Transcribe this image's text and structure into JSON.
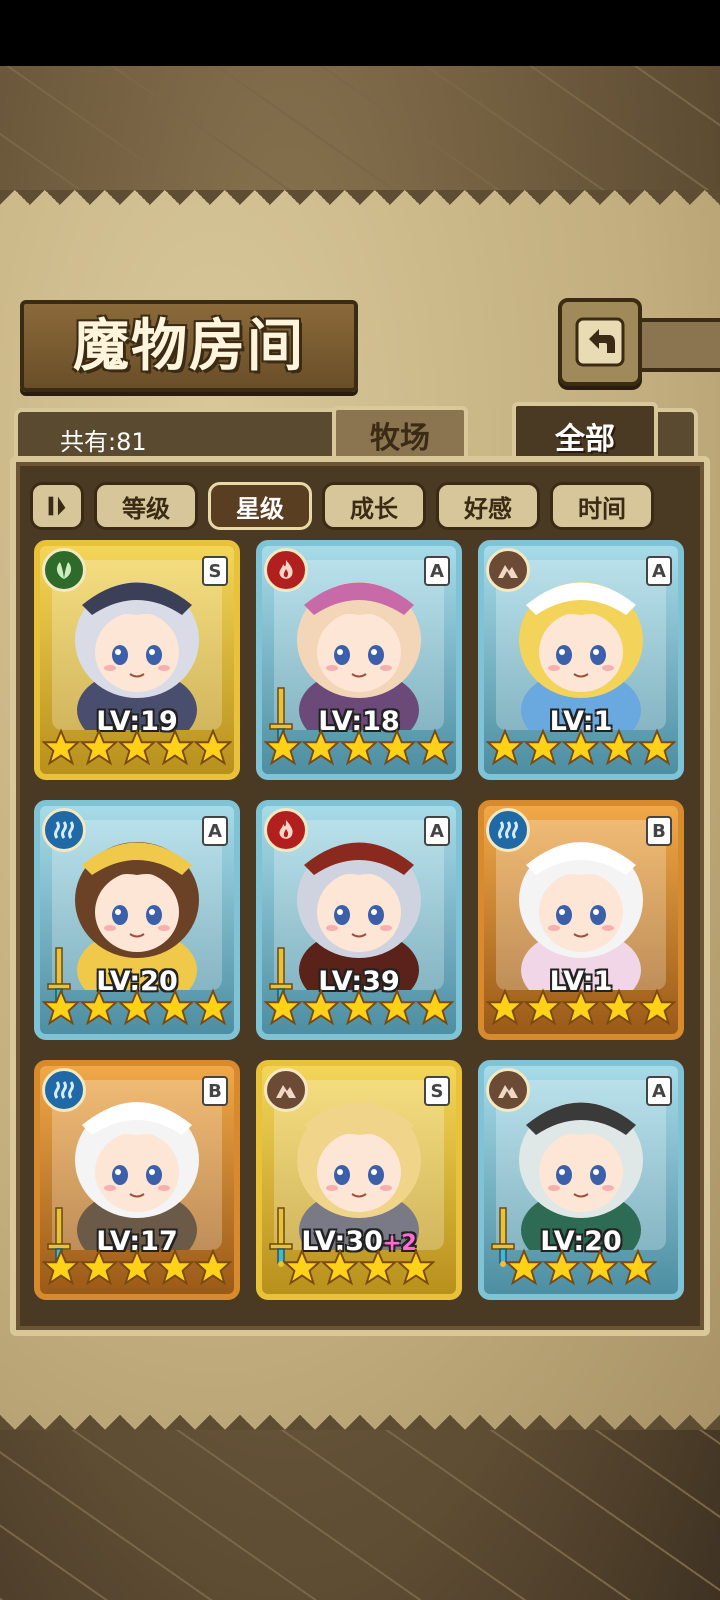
{
  "header": {
    "title": "魔物房间"
  },
  "tabs": {
    "count_label": "共有:81",
    "ranch": "牧场",
    "all": "全部"
  },
  "sort": {
    "buttons": [
      "等级",
      "星级",
      "成长",
      "好感",
      "时间"
    ],
    "active": "星级"
  },
  "monsters": [
    {
      "element": "nature-icon",
      "grade": "S",
      "level": "LV:19",
      "bonus": "",
      "stars": 5,
      "sword": false,
      "hair": "#d9dbe6",
      "hat": "#3c3f58",
      "outfit": "#4a4e6e"
    },
    {
      "element": "fire-icon",
      "grade": "A",
      "level": "LV:18",
      "bonus": "",
      "stars": 5,
      "sword": true,
      "hair": "#f3d6b8",
      "hat": "#c86aa8",
      "outfit": "#6b4a7a"
    },
    {
      "element": "earth-icon",
      "grade": "A",
      "level": "LV:1",
      "bonus": "",
      "stars": 5,
      "sword": false,
      "hair": "#f3d35a",
      "hat": "#ffffff",
      "outfit": "#6aa8e0"
    },
    {
      "element": "water-icon",
      "grade": "A",
      "level": "LV:20",
      "bonus": "",
      "stars": 5,
      "sword": true,
      "hair": "#6b4226",
      "hat": "#f0c84a",
      "outfit": "#f0c84a"
    },
    {
      "element": "fire-icon",
      "grade": "A",
      "level": "LV:39",
      "bonus": "",
      "stars": 5,
      "sword": true,
      "hair": "#cfd3e0",
      "hat": "#8a2a1e",
      "outfit": "#5a2218"
    },
    {
      "element": "water-icon",
      "grade": "B",
      "level": "LV:1",
      "bonus": "",
      "stars": 5,
      "sword": false,
      "hair": "#f4f4f4",
      "hat": "#ffffff",
      "outfit": "#f0d6e6"
    },
    {
      "element": "water-icon",
      "grade": "B",
      "level": "LV:17",
      "bonus": "",
      "stars": 5,
      "sword": true,
      "hair": "#f4f4f4",
      "hat": "#ffffff",
      "outfit": "#6b5a48"
    },
    {
      "element": "earth-icon",
      "grade": "S",
      "level": "LV:30",
      "bonus": "+2",
      "stars": 4,
      "sword": true,
      "hair": "#f0d48a",
      "hat": "#f0d48a",
      "outfit": "#7a7a86"
    },
    {
      "element": "earth-icon",
      "grade": "A",
      "level": "LV:20",
      "bonus": "",
      "stars": 4,
      "sword": true,
      "hair": "#dfe8e6",
      "hat": "#3a3a3a",
      "outfit": "#2e6b54"
    }
  ],
  "colors": {
    "panel": "#4a3a24",
    "frame": "#d9c99a",
    "star": "#ffd21a"
  }
}
